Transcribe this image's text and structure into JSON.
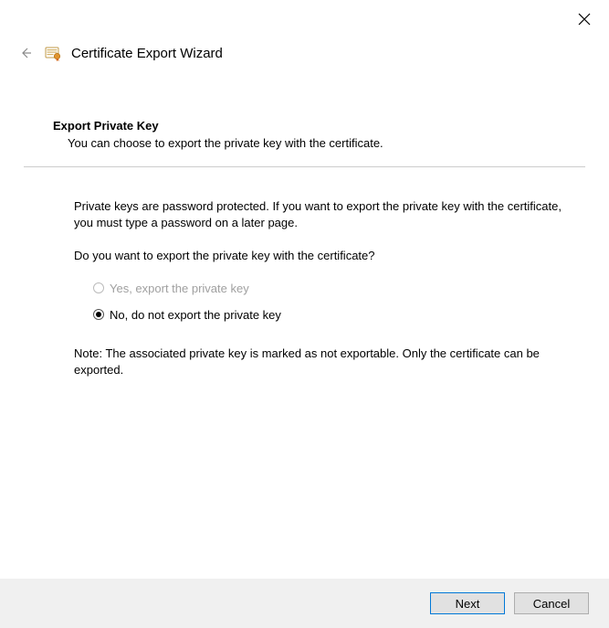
{
  "window": {
    "title": "Certificate Export Wizard"
  },
  "page": {
    "heading": "Export Private Key",
    "subheading": "You can choose to export the private key with the certificate.",
    "intro": "Private keys are password protected. If you want to export the private key with the certificate, you must type a password on a later page.",
    "question": "Do you want to export the private key with the certificate?",
    "options": {
      "yes": "Yes, export the private key",
      "no": "No, do not export the private key"
    },
    "note": "Note: The associated private key is marked as not exportable. Only the certificate can be exported."
  },
  "buttons": {
    "next": "Next",
    "cancel": "Cancel"
  }
}
